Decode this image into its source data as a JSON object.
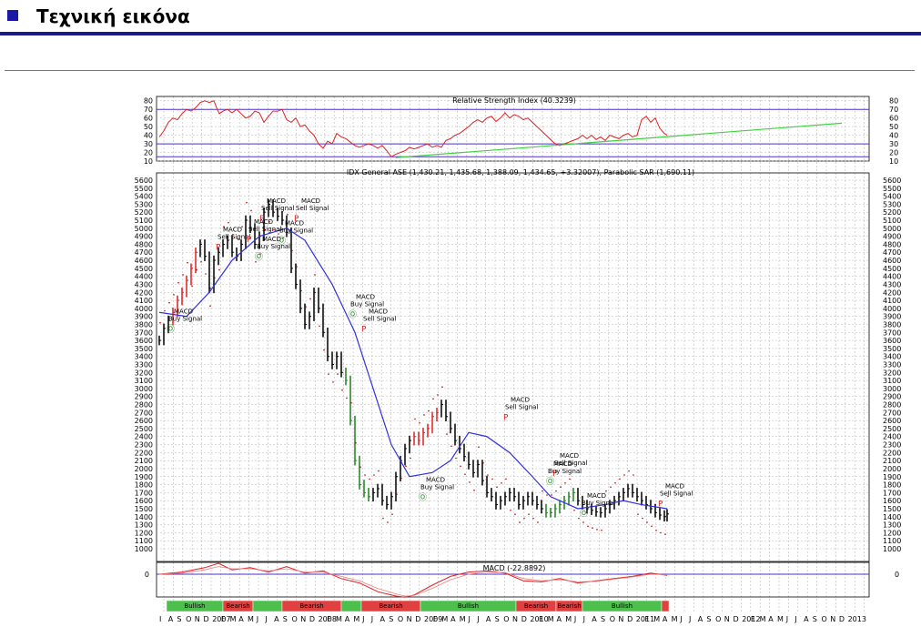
{
  "header": {
    "title": "Τεχνική εικόνα",
    "accent": "#1a1aa6"
  },
  "chart_data": {
    "type": "line",
    "rsi": {
      "label": "Relative Strength Index (40.3239)",
      "ticks": [
        80,
        70,
        60,
        50,
        40,
        30,
        20,
        10
      ],
      "levels": [
        70,
        30,
        15
      ],
      "ylim": [
        10,
        85
      ],
      "x": [
        0,
        5,
        10,
        15,
        20,
        25,
        30,
        35,
        40,
        45,
        50,
        55,
        60,
        63,
        66,
        70,
        75,
        80,
        85,
        90,
        95,
        100,
        105,
        110,
        115,
        120,
        125,
        130,
        135,
        140,
        145,
        150,
        155,
        160,
        165,
        170,
        175,
        180,
        185,
        190,
        195,
        200,
        205,
        210,
        215,
        220,
        225,
        230,
        235,
        240,
        245,
        250,
        255,
        260,
        265,
        270,
        275,
        280,
        285,
        290,
        295,
        300,
        305,
        310,
        315,
        320,
        325,
        330,
        335,
        340,
        345,
        350,
        355,
        360,
        365,
        370,
        375,
        380,
        385,
        390,
        395,
        400,
        405,
        410,
        415,
        420,
        425,
        430,
        435,
        440,
        445,
        450,
        455,
        460,
        465,
        470,
        475,
        480,
        485,
        490,
        495,
        500,
        505,
        510,
        515,
        520,
        525,
        530,
        535,
        540,
        545,
        550,
        555,
        558
      ],
      "y": [
        38,
        45,
        55,
        60,
        58,
        65,
        70,
        68,
        72,
        78,
        80,
        78,
        80,
        72,
        65,
        68,
        70,
        66,
        70,
        65,
        60,
        62,
        68,
        66,
        55,
        62,
        68,
        68,
        70,
        58,
        55,
        60,
        50,
        52,
        45,
        40,
        30,
        25,
        33,
        30,
        42,
        38,
        36,
        32,
        28,
        26,
        28,
        30,
        28,
        25,
        28,
        22,
        15,
        18,
        20,
        22,
        26,
        24,
        26,
        28,
        30,
        26,
        28,
        26,
        34,
        36,
        40,
        42,
        46,
        50,
        55,
        58,
        55,
        60,
        62,
        56,
        60,
        66,
        60,
        64,
        62,
        58,
        60,
        55,
        50,
        45,
        40,
        35,
        30,
        28,
        30,
        32,
        34,
        36,
        40,
        36,
        40,
        35,
        38,
        34,
        40,
        38,
        36,
        40,
        42,
        38,
        40,
        58,
        62,
        55,
        60,
        48,
        42,
        40
      ],
      "trend_x": [
        260,
        750
      ],
      "trend_y": [
        14,
        54
      ]
    },
    "price": {
      "label": "IDX General ASE (1,430.21, 1,435.68, 1,388.09, 1,434.65, +3.32007), Parabolic SAR (1,690.11)",
      "ticks": [
        5600,
        5500,
        5400,
        5300,
        5200,
        5100,
        5000,
        4900,
        4800,
        4700,
        4600,
        4500,
        4400,
        4300,
        4200,
        4100,
        4000,
        3900,
        3800,
        3700,
        3600,
        3500,
        3400,
        3300,
        3200,
        3100,
        3000,
        2900,
        2800,
        2700,
        2600,
        2500,
        2400,
        2300,
        2200,
        2100,
        2000,
        1900,
        1800,
        1700,
        1600,
        1500,
        1400,
        1300,
        1200,
        1100,
        1000
      ],
      "ylim": [
        1000,
        5600
      ],
      "x": [
        0,
        5,
        10,
        15,
        20,
        25,
        30,
        35,
        40,
        45,
        50,
        55,
        60,
        65,
        70,
        75,
        80,
        85,
        90,
        95,
        100,
        105,
        110,
        115,
        120,
        125,
        130,
        135,
        140,
        145,
        150,
        155,
        160,
        165,
        170,
        175,
        180,
        185,
        190,
        195,
        200,
        205,
        210,
        215,
        220,
        225,
        230,
        235,
        240,
        245,
        250,
        255,
        260,
        265,
        270,
        275,
        280,
        285,
        290,
        295,
        300,
        305,
        310,
        315,
        320,
        325,
        330,
        335,
        340,
        345,
        350,
        355,
        360,
        365,
        370,
        375,
        380,
        385,
        390,
        395,
        400,
        405,
        410,
        415,
        420,
        425,
        430,
        435,
        440,
        445,
        450,
        455,
        460,
        465,
        470,
        475,
        480,
        485,
        490,
        495,
        500,
        505,
        510,
        515,
        520,
        525,
        530,
        535,
        540,
        545,
        550,
        555,
        558
      ],
      "y": [
        3600,
        3750,
        3850,
        3950,
        4100,
        4200,
        4350,
        4500,
        4700,
        4800,
        4650,
        4250,
        4600,
        4700,
        4800,
        4850,
        4700,
        4650,
        4800,
        5100,
        5000,
        4800,
        4900,
        5200,
        5300,
        5200,
        5150,
        5100,
        4950,
        4500,
        4300,
        4000,
        3800,
        3900,
        4200,
        4000,
        3700,
        3400,
        3300,
        3400,
        3200,
        3100,
        2600,
        2100,
        1800,
        1700,
        1650,
        1700,
        1750,
        1600,
        1550,
        1650,
        1900,
        2100,
        2250,
        2350,
        2400,
        2350,
        2450,
        2500,
        2650,
        2700,
        2800,
        2650,
        2500,
        2350,
        2250,
        2150,
        2050,
        1950,
        2050,
        1850,
        1700,
        1650,
        1550,
        1600,
        1650,
        1700,
        1650,
        1550,
        1600,
        1650,
        1600,
        1550,
        1500,
        1450,
        1450,
        1500,
        1550,
        1600,
        1650,
        1700,
        1600,
        1550,
        1500,
        1480,
        1460,
        1450,
        1500,
        1550,
        1600,
        1650,
        1700,
        1750,
        1700,
        1650,
        1600,
        1550,
        1500,
        1450,
        1420,
        1400,
        1434
      ],
      "ma_x": [
        0,
        30,
        55,
        80,
        110,
        140,
        160,
        190,
        215,
        235,
        255,
        275,
        300,
        320,
        340,
        360,
        385,
        410,
        430,
        460,
        490,
        510,
        530,
        558
      ],
      "ma_y": [
        3950,
        3900,
        4200,
        4600,
        4900,
        5000,
        4850,
        4300,
        3700,
        3000,
        2300,
        1900,
        1950,
        2100,
        2450,
        2400,
        2200,
        1900,
        1650,
        1500,
        1550,
        1600,
        1550,
        1500
      ],
      "annotations": [
        {
          "line1": "MACD",
          "line2": "Buy Signal",
          "marker": "Ⓞ",
          "x": 8,
          "y": 3800
        },
        {
          "line1": "MACD",
          "line2": "Sell Signal",
          "marker": "P",
          "x": 62,
          "y": 4820
        },
        {
          "line1": "MACD",
          "line2": "Sell Signal",
          "marker": "P",
          "x": 96,
          "y": 4920
        },
        {
          "line1": "MACD",
          "line2": "Sell Signal",
          "marker": "P",
          "x": 110,
          "y": 5180
        },
        {
          "line1": "MACD",
          "line2": "Buy Signal",
          "marker": "Ⓞ",
          "x": 105,
          "y": 4700
        },
        {
          "line1": "MACD",
          "line2": "Buy Signal",
          "marker": "Ⓞ",
          "x": 130,
          "y": 4900
        },
        {
          "line1": "MACD",
          "line2": "Sell Signal",
          "marker": "P",
          "x": 148,
          "y": 5180
        },
        {
          "line1": "MACD",
          "line2": "Sell Signal",
          "marker": "P",
          "x": 222,
          "y": 3800
        },
        {
          "line1": "MACD",
          "line2": "Buy Signal",
          "marker": "Ⓞ",
          "x": 208,
          "y": 3980
        },
        {
          "line1": "MACD",
          "line2": "Buy Signal",
          "marker": "Ⓞ",
          "x": 285,
          "y": 1700
        },
        {
          "line1": "MACD",
          "line2": "Sell Signal",
          "marker": "P",
          "x": 378,
          "y": 2700
        },
        {
          "line1": "MACD",
          "line2": "Sell Signal",
          "marker": "P",
          "x": 432,
          "y": 2000
        },
        {
          "line1": "MACD",
          "line2": "Buy Signal",
          "marker": "Ⓞ",
          "x": 425,
          "y": 1900
        },
        {
          "line1": "MACD",
          "line2": "Buy Signal",
          "marker": "Ⓞ",
          "x": 462,
          "y": 1500
        },
        {
          "line1": "MACD",
          "line2": "Sell Signal",
          "marker": "P",
          "x": 548,
          "y": 1620
        }
      ]
    },
    "macd": {
      "label": "MACD (-22.8892)",
      "ticks": [
        0
      ],
      "x": [
        0,
        25,
        50,
        65,
        80,
        100,
        120,
        140,
        160,
        180,
        200,
        220,
        240,
        260,
        270,
        280,
        300,
        320,
        340,
        360,
        380,
        400,
        420,
        440,
        460,
        480,
        500,
        520,
        540,
        558
      ],
      "y": [
        0,
        20,
        60,
        100,
        40,
        60,
        20,
        70,
        10,
        30,
        -40,
        -80,
        -160,
        -200,
        -210,
        -190,
        -100,
        -20,
        20,
        30,
        10,
        -60,
        -70,
        -40,
        -80,
        -60,
        -40,
        -20,
        10,
        -10
      ],
      "signal_y": [
        0,
        10,
        40,
        70,
        50,
        50,
        30,
        50,
        20,
        20,
        -20,
        -60,
        -130,
        -180,
        -200,
        -195,
        -130,
        -50,
        0,
        20,
        15,
        -40,
        -60,
        -50,
        -70,
        -65,
        -45,
        -25,
        0,
        -5
      ],
      "ylim": [
        -260,
        160
      ]
    },
    "trend_bar": {
      "segments": [
        {
          "label": "Bullish",
          "state": "bull",
          "x0": 8,
          "x1": 70
        },
        {
          "label": "Bearish",
          "state": "bear",
          "x0": 70,
          "x1": 103
        },
        {
          "label": "",
          "state": "bull",
          "x0": 103,
          "x1": 135
        },
        {
          "label": "Bearish",
          "state": "bear",
          "x0": 135,
          "x1": 200
        },
        {
          "label": "",
          "state": "bull",
          "x0": 200,
          "x1": 222
        },
        {
          "label": "Bearish",
          "state": "bear",
          "x0": 222,
          "x1": 287
        },
        {
          "label": "Bullish",
          "state": "bull",
          "x0": 287,
          "x1": 392
        },
        {
          "label": "Bearish",
          "state": "bear",
          "x0": 392,
          "x1": 436
        },
        {
          "label": "Bearish",
          "state": "bear",
          "x0": 436,
          "x1": 465
        },
        {
          "label": "Bullish",
          "state": "bull",
          "x0": 465,
          "x1": 552
        },
        {
          "label": "",
          "state": "bear",
          "x0": 552,
          "x1": 560
        }
      ],
      "bull_color": "#4cbf4c",
      "bear_color": "#e04040"
    },
    "x_axis": {
      "labels": [
        "I",
        "A",
        "S",
        "O",
        "N",
        "D",
        "2007",
        "F",
        "M",
        "A",
        "M",
        "J",
        "J",
        "A",
        "S",
        "O",
        "N",
        "D",
        "2008",
        "F",
        "M",
        "A",
        "M",
        "J",
        "J",
        "A",
        "S",
        "O",
        "N",
        "D",
        "2009",
        "F",
        "M",
        "A",
        "M",
        "J",
        "J",
        "A",
        "S",
        "O",
        "N",
        "D",
        "2010",
        "F",
        "M",
        "A",
        "M",
        "J",
        "J",
        "A",
        "S",
        "O",
        "N",
        "D",
        "2011",
        "F",
        "M",
        "A",
        "M",
        "J",
        "J",
        "A",
        "S",
        "O",
        "N",
        "D",
        "2012",
        "F",
        "M",
        "A",
        "M",
        "J",
        "J",
        "A",
        "S",
        "O",
        "N",
        "D",
        "2013"
      ]
    },
    "colors": {
      "rsi": "#e02020",
      "trendline": "#40d040",
      "levels": "#4b30c8",
      "ma": "#3030e0",
      "bull_bar": "#208020",
      "bear_bar": "#e02020",
      "sar": "#c00000"
    }
  }
}
